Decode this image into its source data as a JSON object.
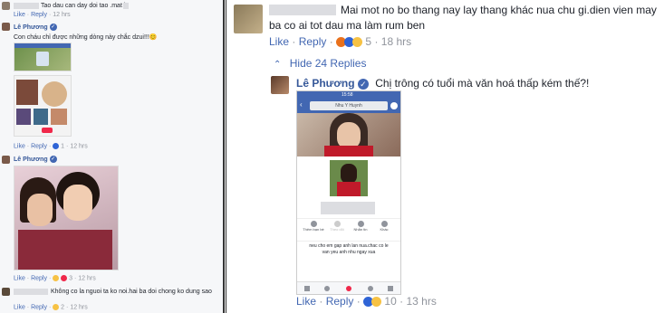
{
  "left_panel": {
    "top_comment": {
      "text": "Tao dau can day doi tao .mat l",
      "actions": [
        "Like",
        "Reply"
      ],
      "time": "12 hrs"
    },
    "comment1": {
      "author": "Lê Phương",
      "text": "Con cháu chỉ được những dòng này chắc dzui!!!",
      "emoji": "😊",
      "actions": [
        "Like",
        "Reply"
      ],
      "reactions_count": "1",
      "time": "12 hrs"
    },
    "comment2": {
      "author": "Lê Phương",
      "actions": [
        "Like",
        "Reply"
      ],
      "reactions_count": "3",
      "time": "12 hrs"
    },
    "comment3": {
      "text": "Không co la nguoi ta ko noi.hai ba doi chong ko dung sao",
      "actions": [
        "Like",
        "Reply"
      ],
      "reactions_count": "2",
      "time": "12 hrs"
    }
  },
  "right_panel": {
    "comment_main": {
      "text_line1": "Mai mot no bo thang nay lay thang khác nua chu gi.dien vien may",
      "text_line2": "ba co ai tot dau ma làm rum ben",
      "actions": [
        "Like",
        "Reply"
      ],
      "reactions_count": "5",
      "time": "18 hrs"
    },
    "hide_replies": "Hide 24 Replies",
    "reply": {
      "author": "Lê Phương",
      "text": "Chị trông có tuổi mà văn hoá thấp kém thế?!",
      "actions": [
        "Like",
        "Reply"
      ],
      "reactions_count": "10",
      "time": "13 hrs"
    },
    "phone": {
      "clock": "15:58",
      "search_name": "Nhu Y Huynh",
      "buttons": [
        "Thêm bạn bè",
        "Theo dõi",
        "Nhắn tin",
        "Khác"
      ],
      "caption_line1": "neu cho em gap anh lan nua.chac co le",
      "caption_line2": "van yeu anh nhu ngay xua"
    }
  },
  "colors": {
    "link": "#4267b2",
    "name": "#365899",
    "meta": "#90949c",
    "fb_blue": "#4267b2",
    "like_blue": "#2f64d6",
    "love_red": "#f0284a",
    "haha_yellow": "#f7c244"
  }
}
